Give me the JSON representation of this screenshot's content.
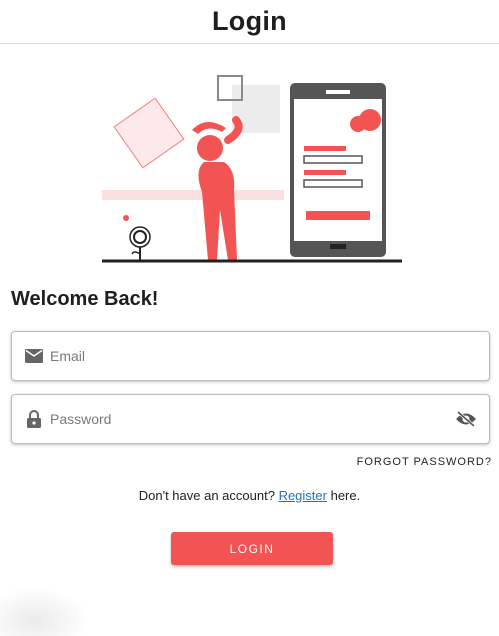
{
  "header": {
    "title": "Login"
  },
  "main": {
    "welcome": "Welcome Back!",
    "email": {
      "placeholder": "Email",
      "value": "",
      "icon": "mail-icon"
    },
    "password": {
      "placeholder": "Password",
      "value": "",
      "icon": "lock-icon",
      "toggle_icon": "eye-off-icon"
    },
    "forgot_label": "FORGOT PASSWORD?",
    "register": {
      "prefix": "Don't have an account? ",
      "link": "Register",
      "suffix": " here."
    },
    "login_label": "LOGIN"
  },
  "colors": {
    "accent": "#f25454",
    "link": "#1e73be"
  }
}
